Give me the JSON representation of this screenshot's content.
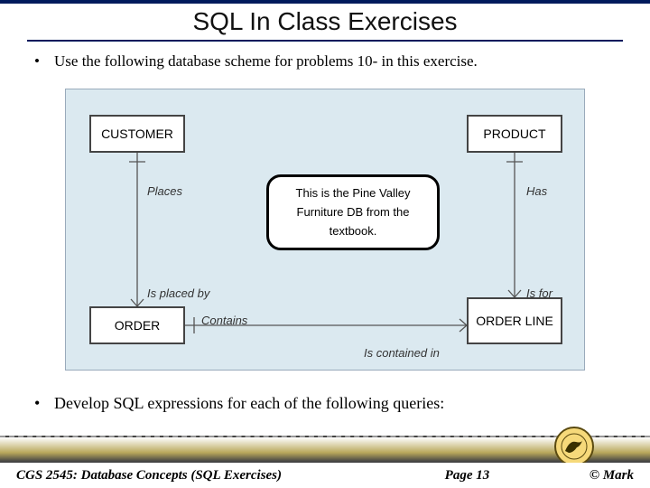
{
  "title": "SQL In Class Exercises",
  "bullets": {
    "intro": "Use the following database scheme for problems 10- in this exercise.",
    "task": "Develop SQL expressions for each of the following queries:"
  },
  "entities": {
    "customer": "CUSTOMER",
    "product": "PRODUCT",
    "order": "ORDER",
    "orderline": "ORDER LINE"
  },
  "relations": {
    "places": "Places",
    "isPlacedBy": "Is placed by",
    "has": "Has",
    "isFor": "Is for",
    "contains": "Contains",
    "isContainedIn": "Is contained in"
  },
  "note": {
    "line1": "This is the Pine Valley",
    "line2": "Furniture DB from the",
    "line3": "textbook."
  },
  "footer": {
    "course": "CGS 2545: Database Concepts  (SQL Exercises)",
    "page": "Page 13",
    "copyright": "© Mark"
  }
}
